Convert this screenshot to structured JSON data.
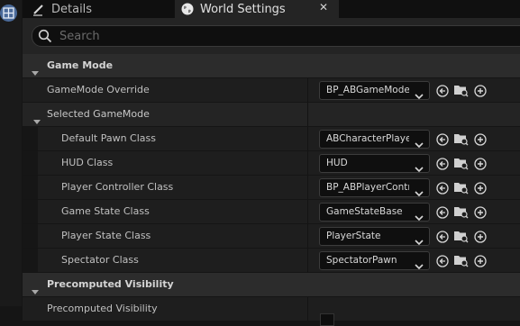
{
  "tabs": [
    {
      "label": "Details"
    },
    {
      "label": "World Settings"
    }
  ],
  "search": {
    "placeholder": "Search"
  },
  "rows": [
    {
      "kind": "category",
      "label": "Game Mode"
    },
    {
      "kind": "property",
      "label": "GameMode Override",
      "value": "BP_ABGameMode"
    },
    {
      "kind": "subcategory",
      "label": "Selected GameMode"
    },
    {
      "kind": "property",
      "label": "Default Pawn Class",
      "value": "ABCharacterPlayer"
    },
    {
      "kind": "property",
      "label": "HUD Class",
      "value": "HUD"
    },
    {
      "kind": "property",
      "label": "Player Controller Class",
      "value": "BP_ABPlayerController"
    },
    {
      "kind": "property",
      "label": "Game State Class",
      "value": "GameStateBase"
    },
    {
      "kind": "property",
      "label": "Player State Class",
      "value": "PlayerState"
    },
    {
      "kind": "property",
      "label": "Spectator Class",
      "value": "SpectatorPawn"
    },
    {
      "kind": "category",
      "label": "Precomputed Visibility"
    },
    {
      "kind": "property",
      "label": "Precomputed Visibility"
    }
  ],
  "icons": {
    "level_editor": "grid-icon",
    "details_tab": "pencil-icon",
    "world_tab": "globe-icon",
    "close": "close-icon",
    "search": "search-icon",
    "row_actions": [
      "use-selected-arrow-icon",
      "browse-folder-icon",
      "add-plus-icon"
    ]
  },
  "colors": {
    "background": "#151515",
    "category_row": "#2c2c2c",
    "property_row": "#1e1e1e",
    "combo_bg": "#0f0f0f",
    "text": "#c0c0c0",
    "level_editor_icon": "#4a6a9a"
  }
}
